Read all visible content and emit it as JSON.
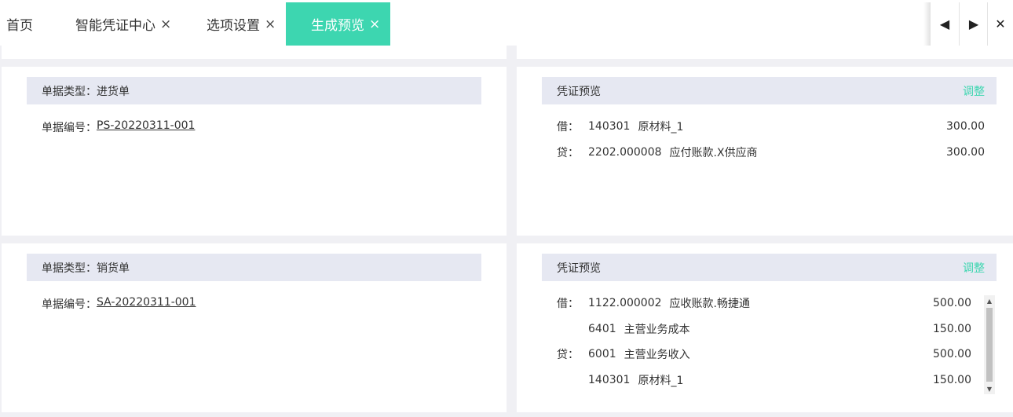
{
  "tabs": [
    {
      "label": "首页",
      "closable": false,
      "active": false
    },
    {
      "label": "智能凭证中心",
      "closable": true,
      "active": false
    },
    {
      "label": "选项设置",
      "closable": true,
      "active": false
    },
    {
      "label": "生成预览",
      "closable": true,
      "active": true
    }
  ],
  "tab_close_glyph": "×",
  "nav": {
    "prev_glyph": "◀",
    "next_glyph": "▶",
    "close_glyph": "✕"
  },
  "colors": {
    "accent": "#3dd6b0",
    "header_bar": "#e6e8f2",
    "page_bg": "#f0f0f4"
  },
  "entries": [
    {
      "bill_type_label": "单据类型：进货单",
      "bill_no_label": "单据编号：",
      "bill_no": "PS-20220311-001",
      "preview_title": "凭证预览",
      "adjust_label": "调整",
      "lines": [
        {
          "dir": "借：",
          "account": "140301",
          "name": "原材料_1",
          "amount": "300.00"
        },
        {
          "dir": "贷：",
          "account": "2202.000008",
          "name": "应付账款.X供应商",
          "amount": "300.00"
        }
      ]
    },
    {
      "bill_type_label": "单据类型：销货单",
      "bill_no_label": "单据编号：",
      "bill_no": "SA-20220311-001",
      "preview_title": "凭证预览",
      "adjust_label": "调整",
      "lines": [
        {
          "dir": "借：",
          "account": "1122.000002",
          "name": "应收账款.畅捷通",
          "amount": "500.00"
        },
        {
          "dir": "",
          "account": "6401",
          "name": "主营业务成本",
          "amount": "150.00"
        },
        {
          "dir": "贷：",
          "account": "6001",
          "name": "主营业务收入",
          "amount": "500.00"
        },
        {
          "dir": "",
          "account": "140301",
          "name": "原材料_1",
          "amount": "150.00"
        }
      ]
    }
  ]
}
